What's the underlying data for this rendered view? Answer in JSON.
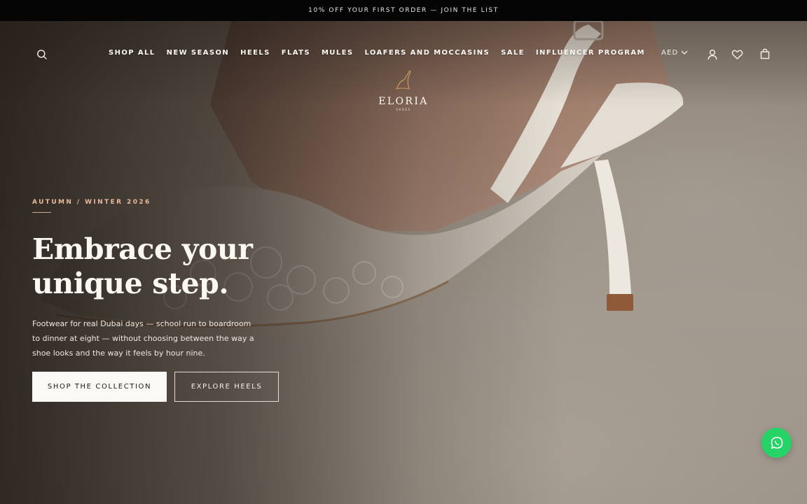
{
  "announcement": {
    "text": "10% OFF YOUR FIRST ORDER — JOIN THE LIST"
  },
  "nav": {
    "links": [
      "SHOP ALL",
      "NEW SEASON",
      "HEELS",
      "FLATS",
      "MULES",
      "LOAFERS AND MOCCASINS",
      "SALE",
      "INFLUENCER PROGRAM"
    ],
    "currency": "AED"
  },
  "brand": {
    "name": "ELORIA",
    "tagline": "SHOES",
    "accent": "#c89a5c"
  },
  "hero": {
    "eyebrow": "AUTUMN / WINTER 2026",
    "headline_line1": "Embrace your",
    "headline_line2": "unique step.",
    "description": "Footwear for real Dubai days — school run to boardroom to dinner at eight — without choosing between the way a shoe looks and the way it feels by hour nine.",
    "primary_cta": "SHOP THE COLLECTION",
    "secondary_cta": "EXPLORE HEELS"
  },
  "colors": {
    "whatsapp": "#25d366",
    "eyebrow": "#e8b99a"
  },
  "icons": [
    "search-icon",
    "account-icon",
    "wishlist-heart-icon",
    "shopping-bag-icon",
    "chevron-down-icon",
    "whatsapp-icon"
  ]
}
